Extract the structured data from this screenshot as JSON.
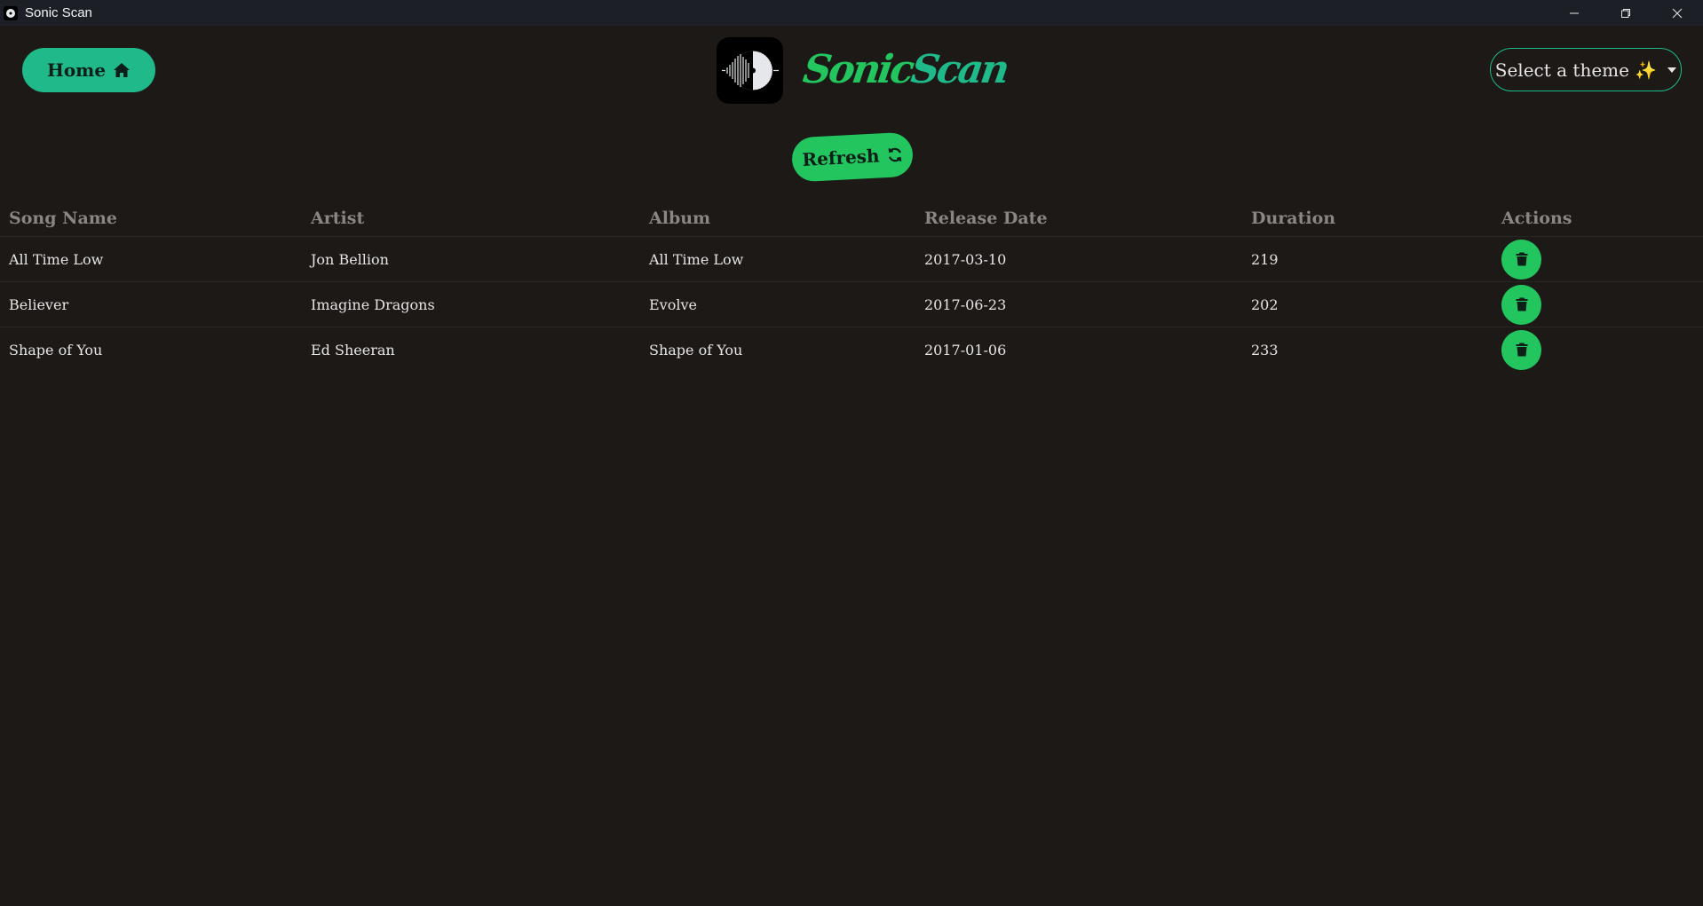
{
  "window": {
    "title": "Sonic Scan",
    "icons": {
      "app": "vinyl-icon",
      "minimize": "minimize-icon",
      "maximize": "restore-icon",
      "close": "close-icon"
    }
  },
  "header": {
    "home_label": "Home",
    "home_icon": "home-icon",
    "brand_part1": "Sonic",
    "brand_part2": "Scan",
    "theme_label": "Select a theme ✨"
  },
  "toolbar": {
    "refresh_label": "Refresh",
    "refresh_icon": "refresh-icon"
  },
  "table": {
    "columns": [
      "Song Name",
      "Artist",
      "Album",
      "Release Date",
      "Duration",
      "Actions"
    ],
    "rows": [
      {
        "song": "All Time Low",
        "artist": "Jon Bellion",
        "album": "All Time Low",
        "release_date": "2017-03-10",
        "duration": "219"
      },
      {
        "song": "Believer",
        "artist": "Imagine Dragons",
        "album": "Evolve",
        "release_date": "2017-06-23",
        "duration": "202"
      },
      {
        "song": "Shape of You",
        "artist": "Ed Sheeran",
        "album": "Shape of You",
        "release_date": "2017-01-06",
        "duration": "233"
      }
    ],
    "row_action_icon": "trash-icon"
  },
  "colors": {
    "background": "#1c1917",
    "accent_teal": "#1fb98a",
    "accent_green": "#22c55e"
  }
}
